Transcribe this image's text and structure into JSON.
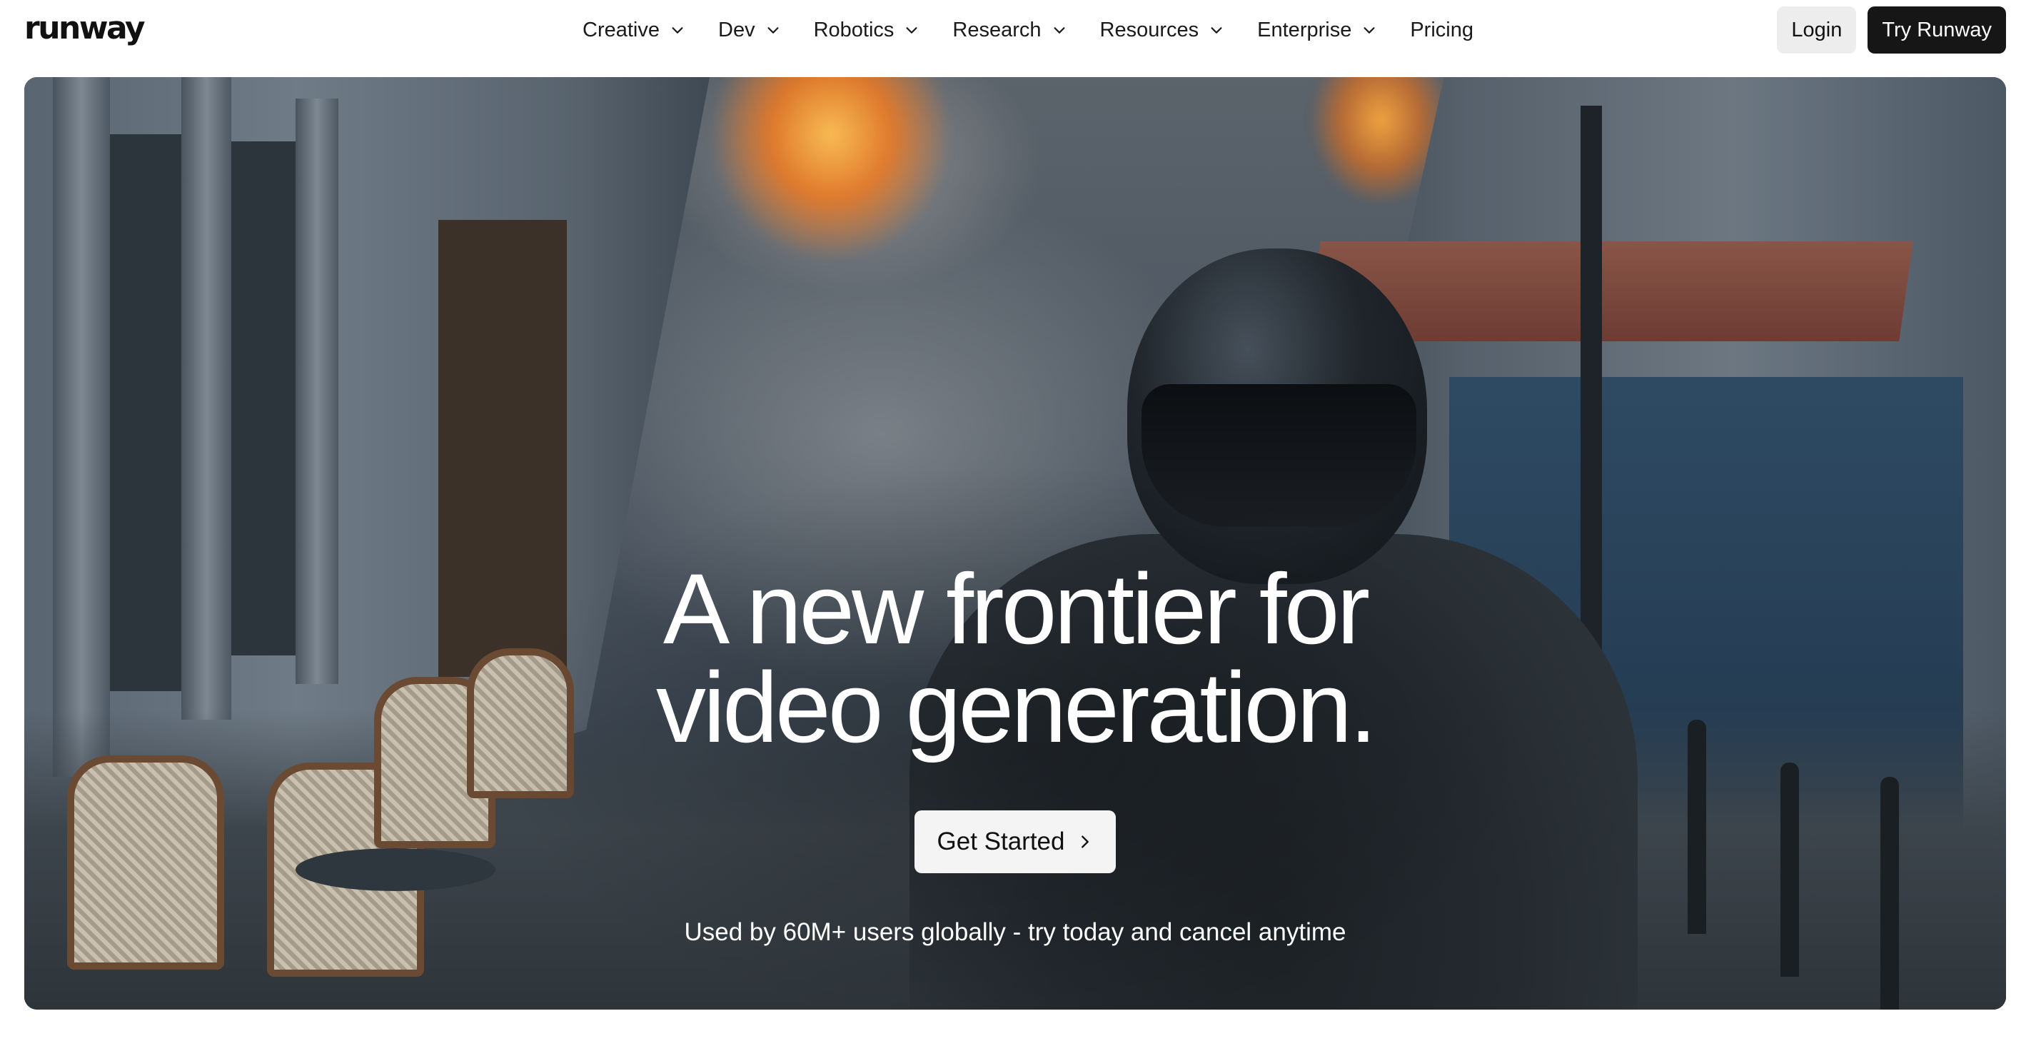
{
  "brand": {
    "logo_text": "runway"
  },
  "nav": {
    "items": [
      {
        "label": "Creative",
        "has_dropdown": true
      },
      {
        "label": "Dev",
        "has_dropdown": true
      },
      {
        "label": "Robotics",
        "has_dropdown": true
      },
      {
        "label": "Research",
        "has_dropdown": true
      },
      {
        "label": "Resources",
        "has_dropdown": true
      },
      {
        "label": "Enterprise",
        "has_dropdown": true
      },
      {
        "label": "Pricing",
        "has_dropdown": false
      }
    ],
    "login_label": "Login",
    "try_label": "Try Runway"
  },
  "hero": {
    "title_line1": "A new frontier for",
    "title_line2": "video generation.",
    "cta_label": "Get Started",
    "subtitle": "Used by 60M+ users globally - try today and cancel anytime",
    "background_media": "motorcycle-rider-explosion-video"
  },
  "colors": {
    "primary_button": "#161616",
    "secondary_button": "#ededed",
    "hero_text": "#ffffff"
  }
}
